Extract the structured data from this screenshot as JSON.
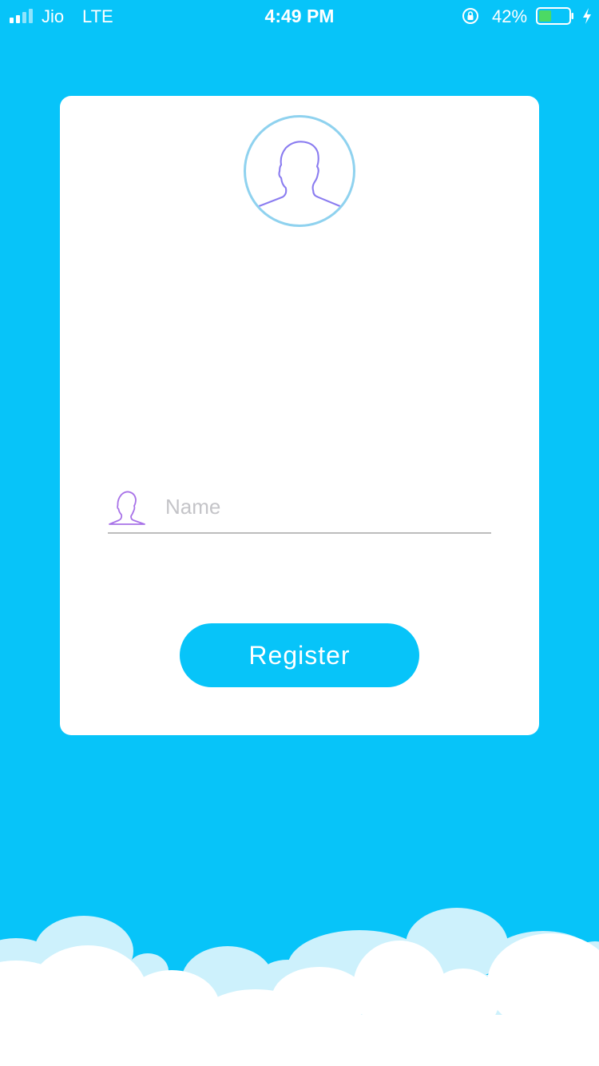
{
  "status_bar": {
    "carrier": "Jio",
    "network": "LTE",
    "time": "4:49 PM",
    "battery_percent": "42%",
    "battery_level": 0.42,
    "icons": [
      "signal-icon",
      "rotation-lock-icon",
      "battery-icon",
      "charging-icon"
    ]
  },
  "register_form": {
    "avatar_icon": "user-silhouette-icon",
    "name_field": {
      "icon": "user-outline-icon",
      "placeholder": "Name",
      "value": ""
    },
    "register_label": "Register"
  },
  "colors": {
    "background": "#07c4f9",
    "card": "#ffffff",
    "button": "#07c4f9",
    "avatar_ring": "#8fd2ef",
    "icon_stroke": "#8a7cf0",
    "field_icon_stroke": "#a872e8",
    "battery_fill": "#4cd964"
  }
}
